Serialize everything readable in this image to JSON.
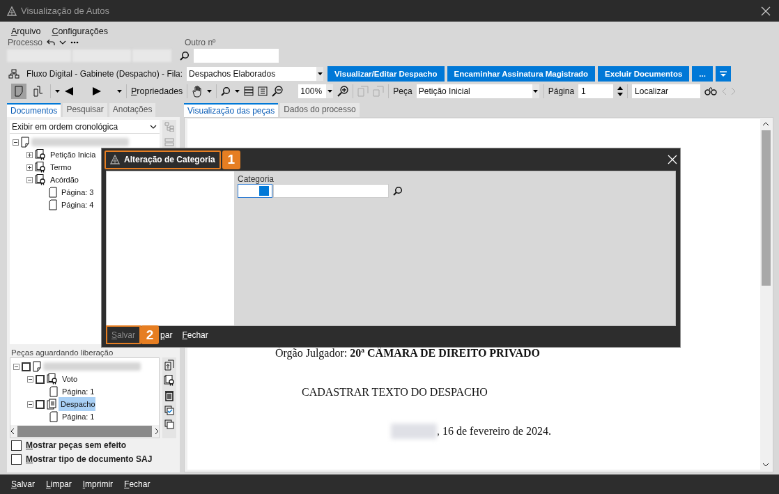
{
  "window": {
    "title": "Visualização de Autos"
  },
  "menu": [
    "Arquivo",
    "Configurações"
  ],
  "process": {
    "label": "Processo",
    "other_label": "Outro nº"
  },
  "flow": {
    "text": "Fluxo Digital - Gabinete (Despacho) - Fila:",
    "queue": "Despachos Elaborados",
    "buttons": [
      "Visualizar/Editar Despacho",
      "Encaminhar Assinatura Magistrado",
      "Excluir Documentos",
      "..."
    ]
  },
  "toolbar": {
    "view_modes": [
      {
        "selected": true
      },
      {
        "selected": false
      }
    ],
    "properties": "Propriedades",
    "zoom": "100%",
    "piece_label": "Peça",
    "piece": "Petição Inicial",
    "page_label": "Página",
    "page": "1",
    "find": "Localizar"
  },
  "left_tabs": [
    {
      "label": "Documentos",
      "selected": true
    },
    {
      "label": "Pesquisar",
      "selected": false
    },
    {
      "label": "Anotações",
      "selected": false
    }
  ],
  "order": "Exibir em ordem cronológica",
  "documents": [
    {
      "kind": "document",
      "expanded": true,
      "children": [
        {
          "kind": "piece",
          "label": "Petição Inicia",
          "expanded": false
        },
        {
          "kind": "piece",
          "label": "Termo",
          "expanded": false
        },
        {
          "kind": "piece",
          "label": "Acórdão",
          "expanded": true,
          "children": [
            {
              "kind": "page",
              "label": "Página: 3"
            },
            {
              "kind": "page",
              "label": "Página: 4"
            }
          ]
        }
      ]
    }
  ],
  "pending": {
    "title": "Peças aguardando liberação",
    "tree": [
      {
        "kind": "document",
        "expanded": true,
        "checked": false,
        "children": [
          {
            "kind": "piece",
            "label": "Voto",
            "expanded": true,
            "checked": false,
            "selected": false,
            "children": [
              {
                "kind": "page",
                "label": "Página: 1"
              }
            ]
          },
          {
            "kind": "draft",
            "label": "Despacho",
            "expanded": true,
            "checked": false,
            "selected": true,
            "children": [
              {
                "kind": "page",
                "label": "Página: 1"
              }
            ]
          }
        ]
      }
    ]
  },
  "options": [
    {
      "label": "Mostrar peças sem efeito",
      "checked": false
    },
    {
      "label": "Mostrar tipo de documento SAJ",
      "checked": false
    }
  ],
  "view_tabs": [
    {
      "label": "Visualização das peças",
      "selected": true
    },
    {
      "label": "Dados do processo",
      "selected": false
    }
  ],
  "document": {
    "lines": [
      "Órgão Julgador: **20ª CÂMARA DE DIREITO PRIVADO**",
      "CADASTRAR TEXTO DO DESPACHO",
      ", 16 de fevereiro de 2024."
    ]
  },
  "footer": [
    "Salvar",
    "Limpar",
    "Imprimir",
    "Fechar"
  ],
  "dialog": {
    "title": "Alteração de Categoria",
    "field_label": "Categoria",
    "footer": [
      {
        "label": "Salvar",
        "disabled": true
      },
      {
        "label": "par",
        "disabled": false
      },
      {
        "label": "Fechar",
        "disabled": false
      }
    ],
    "callouts": [
      "1",
      "2"
    ]
  }
}
